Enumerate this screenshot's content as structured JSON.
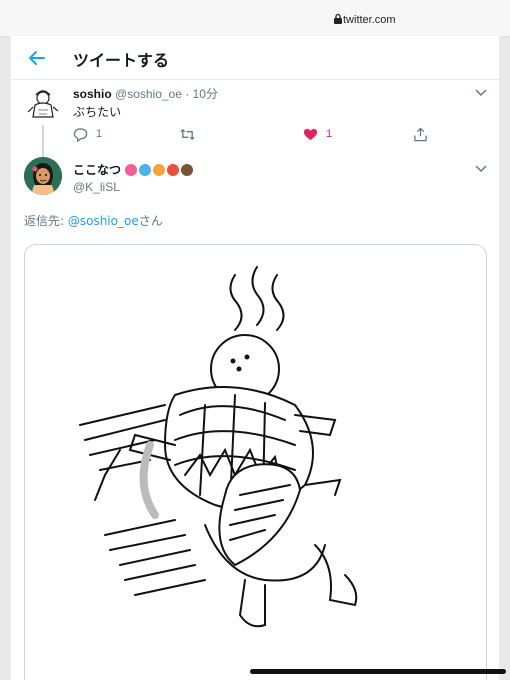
{
  "browser": {
    "url": "twitter.com"
  },
  "header": {
    "title": "ツイートする"
  },
  "parent_tweet": {
    "name": "soshio",
    "handle": "@soshio_oe",
    "separator": "·",
    "time": "10分",
    "text": "ぶちたい",
    "reply_count": "1",
    "like_count": "1"
  },
  "main_tweet": {
    "name": "ここなつ",
    "handle": "@K_liSL",
    "reply_to_prefix": "返信先: ",
    "reply_to_mention": "@soshio_oe",
    "reply_to_suffix": "さん",
    "emojis": [
      "hibiscus-emoji",
      "island-emoji",
      "cocktail-emoji",
      "mango-emoji",
      "coconut-emoji"
    ]
  },
  "colors": {
    "accent": "#1da1f2",
    "like": "#e0245e",
    "muted": "#657786"
  }
}
